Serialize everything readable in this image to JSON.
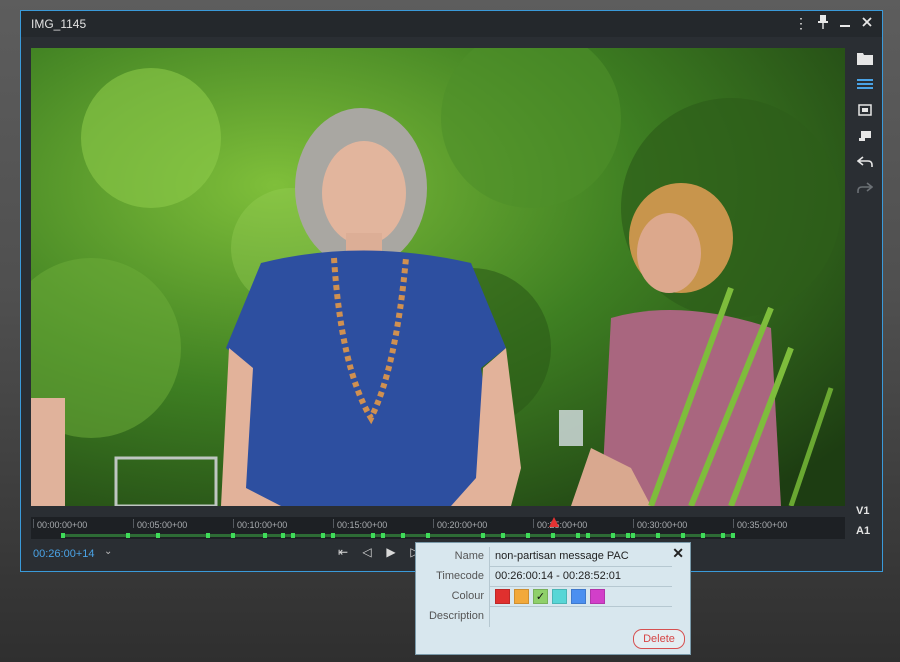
{
  "window": {
    "title": "IMG_1145"
  },
  "titlebar_icons": [
    "more-vertical-icon",
    "pin-icon",
    "minimize-icon",
    "close-icon"
  ],
  "sidebar": {
    "buttons": [
      "folder-icon",
      "list-icon",
      "mark-in-icon",
      "mark-out-icon",
      "undo-icon",
      "redo-icon"
    ]
  },
  "tracks": {
    "video": "V1",
    "audio": "A1"
  },
  "timeline": {
    "ticks": [
      "00:00:00+00",
      "00:05:00+00",
      "00:10:00+00",
      "00:15:00+00",
      "00:20:00+00",
      "00:25:00+00",
      "00:30:00+00",
      "00:35:00+00"
    ],
    "playhead_time": "00:26:00+14"
  },
  "controls": {
    "timecode": "00:26:00+14",
    "dropdown_glyph": "⌄",
    "transport": [
      "⇤",
      "◁",
      "▶",
      "▷"
    ]
  },
  "popup": {
    "name_label": "Name",
    "name_value": "non-partisan message PAC",
    "timecode_label": "Timecode",
    "timecode_value": "00:26:00:14 - 00:28:52:01",
    "colour_label": "Colour",
    "description_label": "Description",
    "description_value": "",
    "delete_label": "Delete",
    "close_glyph": "✕",
    "colours": [
      "#e0302e",
      "#f2a93a",
      "#8fd06a",
      "#57d6d6",
      "#4b8ff0",
      "#d23fc9"
    ],
    "selected_colour_index": 2,
    "check_glyph": "✓"
  },
  "colors": {
    "accent": "#3a9ad9",
    "marker": "#3fdc5a",
    "playhead": "#e33333"
  }
}
